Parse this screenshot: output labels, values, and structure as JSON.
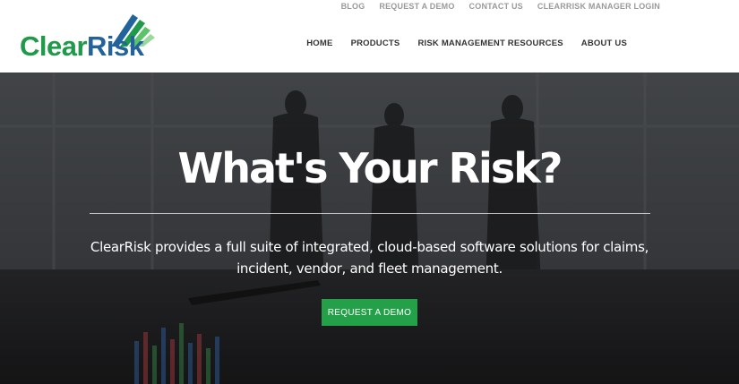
{
  "logo": {
    "part1": "Clear",
    "part2": "Risk",
    "tm": "™",
    "colors": {
      "green": "#1e9a4a",
      "blue": "#21639a"
    }
  },
  "top_nav": {
    "items": [
      "BLOG",
      "REQUEST A DEMO",
      "CONTACT US",
      "CLEARRISK MANAGER LOGIN"
    ]
  },
  "main_nav": {
    "items": [
      "HOME",
      "PRODUCTS",
      "RISK MANAGEMENT RESOURCES",
      "ABOUT US"
    ]
  },
  "hero": {
    "title": "What's Your Risk?",
    "subtitle": "ClearRisk provides a full suite of integrated, cloud-based software solutions for claims, incident, vendor, and fleet management.",
    "cta_label": "REQUEST A DEMO",
    "cta_color": "#24a148"
  }
}
